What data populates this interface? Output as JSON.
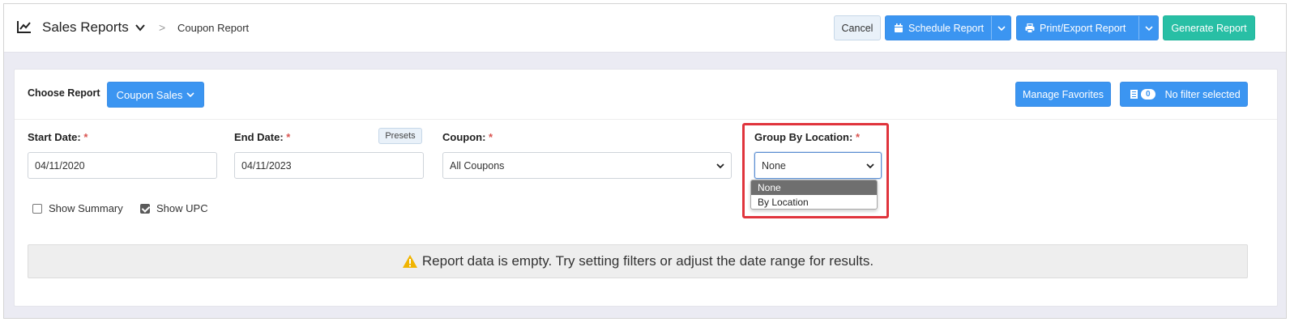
{
  "header": {
    "title": "Sales Reports",
    "separator": ">",
    "breadcrumb": "Coupon Report",
    "cancel_label": "Cancel",
    "schedule_label": "Schedule Report",
    "print_label": "Print/Export Report",
    "generate_label": "Generate Report"
  },
  "toolbar": {
    "choose_label": "Choose Report",
    "report_select_label": "Coupon Sales",
    "manage_favorites_label": "Manage Favorites",
    "filter_count": "0",
    "filter_label": "No filter selected"
  },
  "filters": {
    "start_date_label": "Start Date:",
    "start_date_value": "04/11/2020",
    "end_date_label": "End Date:",
    "end_date_value": "04/11/2023",
    "presets_label": "Presets",
    "coupon_label": "Coupon:",
    "coupon_value": "All Coupons",
    "group_label": "Group By Location:",
    "group_value": "None",
    "required_mark": "*",
    "group_options": [
      "None",
      "By Location"
    ]
  },
  "options": {
    "show_summary_label": "Show Summary",
    "show_summary_checked": false,
    "show_upc_label": "Show UPC",
    "show_upc_checked": true
  },
  "notice": {
    "message": "Report data is empty. Try setting filters or adjust the date range for results."
  },
  "colors": {
    "primary": "#3b95f1",
    "success": "#28bfa5",
    "highlight": "#e0343c",
    "required": "#d9534f",
    "warning": "#f0b400"
  }
}
